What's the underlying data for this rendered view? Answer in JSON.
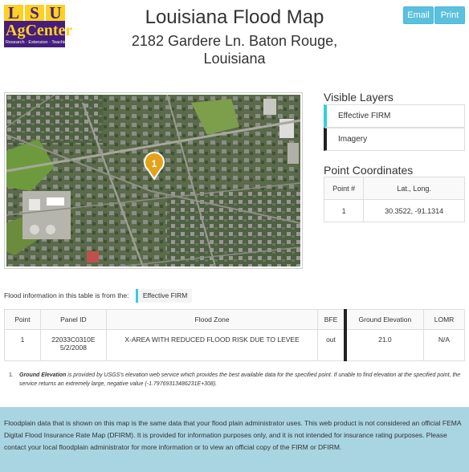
{
  "logo": {
    "letters": [
      "L",
      "S",
      "U"
    ],
    "name": "AgCenter",
    "tagline": "Research · Extension · Teaching"
  },
  "header": {
    "title": "Louisiana Flood Map",
    "address": "2182 Gardere Ln. Baton Rouge, Louisiana",
    "email_label": "Email",
    "print_label": "Print"
  },
  "map": {
    "marker_label": "1",
    "marker_color": "#e6a11b"
  },
  "layers": {
    "title": "Visible Layers",
    "items": [
      {
        "label": "Effective FIRM",
        "accent": "#31d0db"
      },
      {
        "label": "Imagery",
        "accent": "#222222"
      }
    ]
  },
  "coordinates": {
    "title": "Point Coordinates",
    "headers": [
      "Point #",
      "Lat., Long."
    ],
    "rows": [
      [
        "1",
        "30.3522, -91.1314"
      ]
    ]
  },
  "flood_info": {
    "prefix": "Flood information in this table is from the:",
    "source": "Effective FIRM"
  },
  "flood_table": {
    "headers": [
      "Point",
      "Panel ID",
      "Flood Zone",
      "BFE",
      "Ground Elevation",
      "LOMR"
    ],
    "rows": [
      {
        "point": "1",
        "panel_id": "22033C0310E",
        "panel_date": "5/2/2008",
        "zone": "X-AREA WITH REDUCED FLOOD RISK DUE TO LEVEE",
        "bfe": "out",
        "elevation": "21.0",
        "lomr": "N/A"
      }
    ]
  },
  "footnote": {
    "number": "1.",
    "term": "Ground Elevation",
    "text": " is provided by USGS's elevation web service which provides the best available data for the specified point. If unable to find elevation at the specified point, the service returns an extremely large, negative value (-1.79769313486231E+308)."
  },
  "disclaimer": "Floodplain data that is shown on this map is the same data that your flood plain administrator uses. This web product is not considered an official FEMA Digital Flood Insurance Rate Map (DFIRM). It is provided for information purposes only, and it is not intended for insurance rating purposes. Please contact your local floodplain administrator for more information or to view an official copy of the FIRM or DFIRM."
}
